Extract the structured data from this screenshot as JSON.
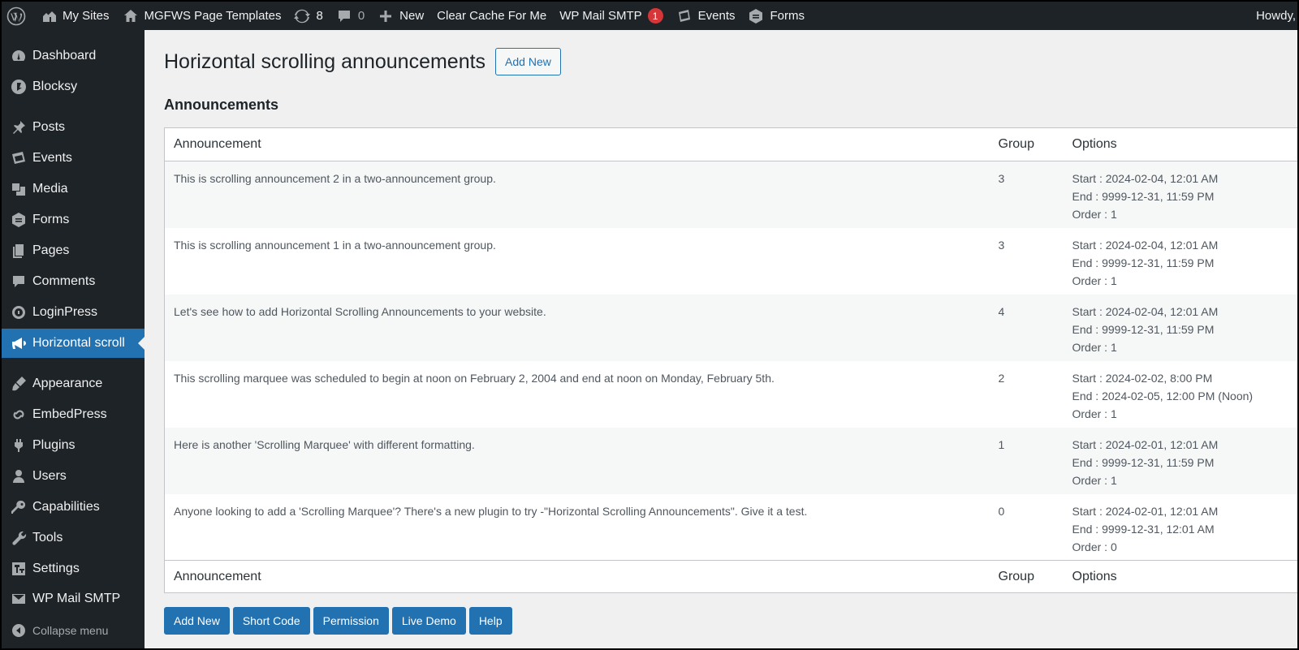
{
  "adminbar": {
    "my_sites": "My Sites",
    "site_name": "MGFWS Page Templates",
    "updates_count": "8",
    "comments_count": "0",
    "new_label": "New",
    "clear_cache": "Clear Cache For Me",
    "wp_mail_smtp": "WP Mail SMTP",
    "wp_mail_smtp_badge": "1",
    "events": "Events",
    "forms": "Forms",
    "howdy": "Howdy,"
  },
  "sidebar": {
    "items": [
      {
        "label": "Dashboard",
        "icon": "dashboard-icon"
      },
      {
        "label": "Blocksy",
        "icon": "blocksy-icon"
      },
      {
        "label": "Posts",
        "icon": "pin-icon"
      },
      {
        "label": "Events",
        "icon": "calendar-icon"
      },
      {
        "label": "Media",
        "icon": "media-icon"
      },
      {
        "label": "Forms",
        "icon": "forms-icon"
      },
      {
        "label": "Pages",
        "icon": "pages-icon"
      },
      {
        "label": "Comments",
        "icon": "comment-icon"
      },
      {
        "label": "LoginPress",
        "icon": "loginpress-icon"
      },
      {
        "label": "Horizontal scroll",
        "icon": "megaphone-icon",
        "current": true
      },
      {
        "label": "Appearance",
        "icon": "brush-icon"
      },
      {
        "label": "EmbedPress",
        "icon": "embedpress-icon"
      },
      {
        "label": "Plugins",
        "icon": "plugin-icon"
      },
      {
        "label": "Users",
        "icon": "users-icon"
      },
      {
        "label": "Capabilities",
        "icon": "key-icon"
      },
      {
        "label": "Tools",
        "icon": "wrench-icon"
      },
      {
        "label": "Settings",
        "icon": "settings-icon"
      },
      {
        "label": "WP Mail SMTP",
        "icon": "mail-icon"
      }
    ],
    "collapse": "Collapse menu"
  },
  "page": {
    "title": "Horizontal scrolling announcements",
    "add_new": "Add New",
    "section_title": "Announcements"
  },
  "table": {
    "headers": {
      "announcement": "Announcement",
      "group": "Group",
      "options": "Options"
    },
    "rows": [
      {
        "announcement": "This is scrolling announcement 2 in a two-announcement group.",
        "group": "3",
        "start": "Start : 2024-02-04, 12:01 AM",
        "end": "End : 9999-12-31, 11:59 PM",
        "order": "Order : 1"
      },
      {
        "announcement": "This is scrolling announcement 1 in a two-announcement group.",
        "group": "3",
        "start": "Start : 2024-02-04, 12:01 AM",
        "end": "End : 9999-12-31, 11:59 PM",
        "order": "Order : 1"
      },
      {
        "announcement": "Let's see how to add Horizontal Scrolling Announcements to your website.",
        "group": "4",
        "start": "Start : 2024-02-04, 12:01 AM",
        "end": "End : 9999-12-31, 11:59 PM",
        "order": "Order : 1"
      },
      {
        "announcement": "This scrolling marquee was scheduled to begin at noon on February 2, 2004 and end at noon on Monday, February 5th.",
        "group": "2",
        "start": "Start : 2024-02-02, 8:00 PM",
        "end": "End : 2024-02-05, 12:00 PM (Noon)",
        "order": "Order : 1"
      },
      {
        "announcement": "Here is another 'Scrolling Marquee' with different formatting.",
        "group": "1",
        "start": "Start : 2024-02-01, 12:01 AM",
        "end": "End : 9999-12-31, 11:59 PM",
        "order": "Order : 1"
      },
      {
        "announcement": "Anyone looking to add a 'Scrolling Marquee'? There's a new plugin to try -\"Horizontal Scrolling Announcements\". Give it a test.",
        "group": "0",
        "start": "Start : 2024-02-01, 12:01 AM",
        "end": "End : 9999-12-31, 12:01 AM",
        "order": "Order : 0"
      }
    ]
  },
  "buttons": {
    "add_new": "Add New",
    "short_code": "Short Code",
    "permission": "Permission",
    "live_demo": "Live Demo",
    "help": "Help"
  },
  "colors": {
    "admin_dark": "#1d2327",
    "accent": "#2271b1",
    "badge_red": "#d63638"
  }
}
